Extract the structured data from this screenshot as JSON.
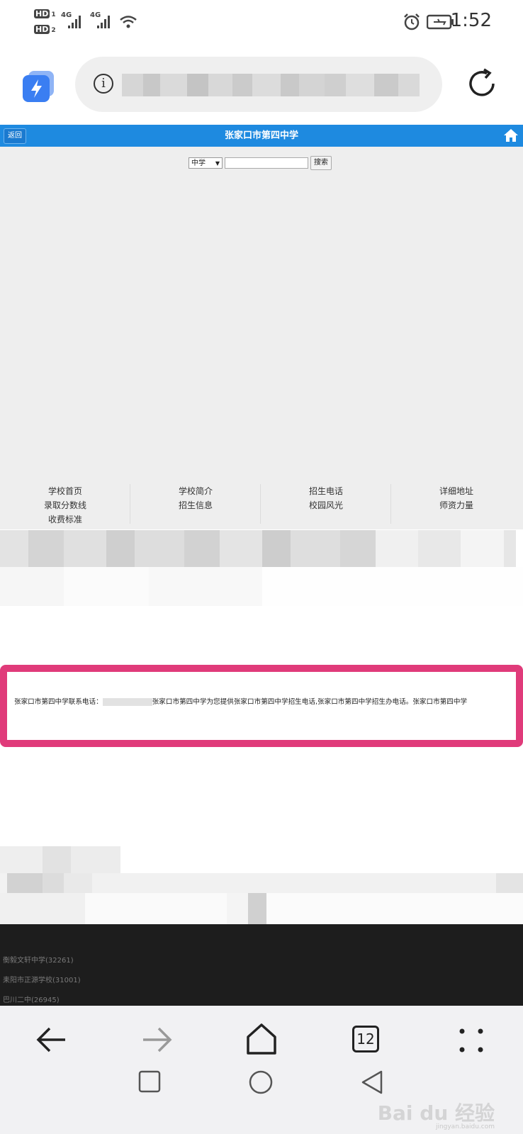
{
  "status_bar": {
    "sim1": "HD",
    "sim1_slot": "1",
    "sim2": "HD",
    "sim2_slot": "2",
    "net1": "4G",
    "net2": "4G",
    "time": "1:52"
  },
  "site": {
    "back_label": "返回",
    "title": "张家口市第四中学"
  },
  "search": {
    "type_value": "中学",
    "button_label": "搜索"
  },
  "nav": {
    "items": [
      "学校首页",
      "学校简介",
      "招生电话",
      "详细地址",
      "录取分数线",
      "招生信息",
      "校园风光",
      "师资力量",
      "收费标准"
    ]
  },
  "contact": {
    "prefix": "张家口市第四中学联系电话：",
    "suffix": "张家口市第四中学为您提供张家口市第四中学招生电话,张家口市第四中学招生办电话。张家口市第四中学"
  },
  "list_dark": {
    "items": [
      "衡毅文轩中学(32261)",
      "耒阳市正源学校(31001)",
      "巴川二中(26945)"
    ]
  },
  "bottom_nav": {
    "tab_count": "12"
  },
  "watermark": {
    "text": "Bai du 经验",
    "sub": "jingyan.baidu.com"
  },
  "colors": {
    "header_blue": "#1e8ae0",
    "highlight_pink": "#e03b7a"
  }
}
